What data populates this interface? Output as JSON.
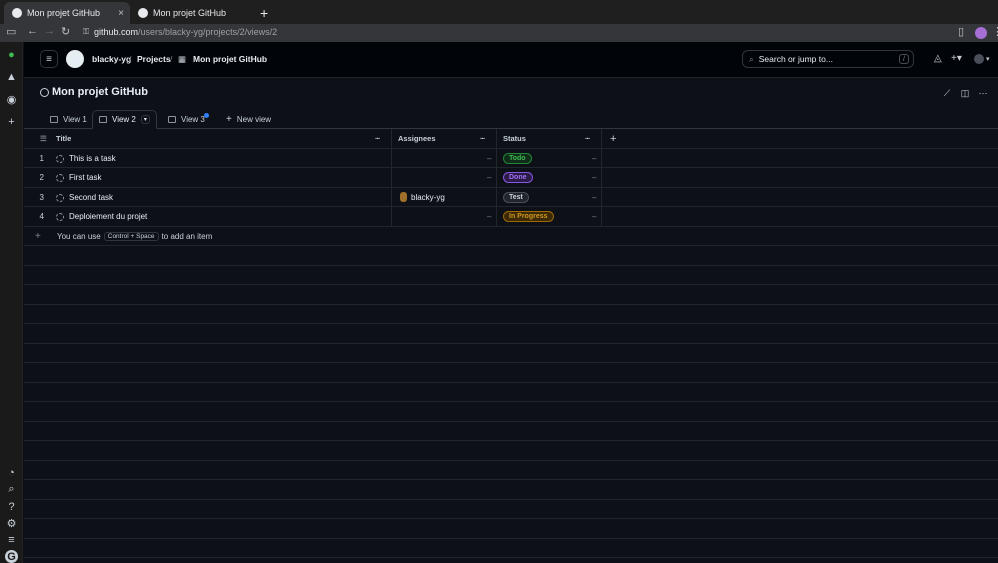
{
  "browser": {
    "tabs": [
      {
        "title": "Mon projet GitHub",
        "close": "×"
      },
      {
        "title": "Mon projet GitHub"
      }
    ],
    "new_tab": "+",
    "url_domain": "github.com",
    "url_path": "/users/blacky-yg/projects/2/views/2"
  },
  "header": {
    "breadcrumbs": [
      "blacky-yg",
      "Projects",
      "Mon projet GitHub"
    ],
    "separators": [
      "/",
      "/"
    ],
    "search_placeholder": "Search or jump to...",
    "search_shortcut": "/"
  },
  "project": {
    "title": "Mon projet GitHub"
  },
  "views": {
    "tabs": [
      {
        "label": "View 1"
      },
      {
        "label": "View 2"
      },
      {
        "label": "View 3"
      }
    ],
    "new_view": "New view"
  },
  "table": {
    "columns": [
      "Title",
      "Assignees",
      "Status"
    ],
    "rows": [
      {
        "num": "1",
        "title": "This is a task",
        "assignee": "",
        "status": "Todo",
        "status_color": "#3fb950",
        "status_bg": "#0f2d19"
      },
      {
        "num": "2",
        "title": "First task",
        "assignee": "",
        "status": "Done",
        "status_color": "#a371f7",
        "status_bg": "#2a1b47"
      },
      {
        "num": "3",
        "title": "Second task",
        "assignee": "blacky-yg",
        "status": "Test",
        "status_color": "#c9d1d9",
        "status_bg": "#21262d"
      },
      {
        "num": "4",
        "title": "Deploiement du projet",
        "assignee": "",
        "status": "In Progress",
        "status_color": "#d29922",
        "status_bg": "#3b2a05"
      }
    ],
    "dash": "–",
    "add_hint_prefix": "You can use",
    "add_hint_kbd": "Control + Space",
    "add_hint_suffix": "to add an item"
  }
}
